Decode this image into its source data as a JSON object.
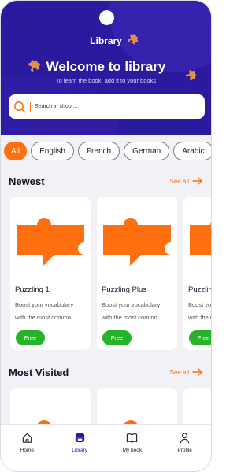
{
  "header": {
    "app_title": "Library",
    "welcome": "Welcome to library",
    "subtitle": "To learn the book, add it to your books"
  },
  "search": {
    "placeholder": "Search in shop ..."
  },
  "languages": [
    {
      "label": "All",
      "active": true
    },
    {
      "label": "English",
      "active": false
    },
    {
      "label": "French",
      "active": false
    },
    {
      "label": "German",
      "active": false
    },
    {
      "label": "Arabic",
      "active": false
    }
  ],
  "newest": {
    "title": "Newest",
    "see_all": "See all",
    "cards": [
      {
        "name": "Puzzling 1",
        "desc_line1": "Boost your vocabulary",
        "desc_line2": "with the most commo...",
        "badge": "Free"
      },
      {
        "name": "Puzzling Plus",
        "desc_line1": "Boost your vocabulary",
        "desc_line2": "with the most commo...",
        "badge": "Free"
      },
      {
        "name": "Puzzling",
        "desc_line1": "Boost your vocabulary",
        "desc_line2": "with the most commo...",
        "badge": "Free"
      }
    ]
  },
  "most_visited": {
    "title": "Most Visited",
    "see_all": "See all"
  },
  "tabbar": {
    "items": [
      {
        "label": "Home",
        "icon": "home-icon"
      },
      {
        "label": "Library",
        "icon": "library-icon",
        "active": true
      },
      {
        "label": "My book",
        "icon": "book-icon"
      },
      {
        "label": "Profile",
        "icon": "profile-icon"
      }
    ]
  },
  "colors": {
    "primary": "#2a1a9e",
    "accent": "#ff6f0f",
    "success": "#26b32a"
  }
}
